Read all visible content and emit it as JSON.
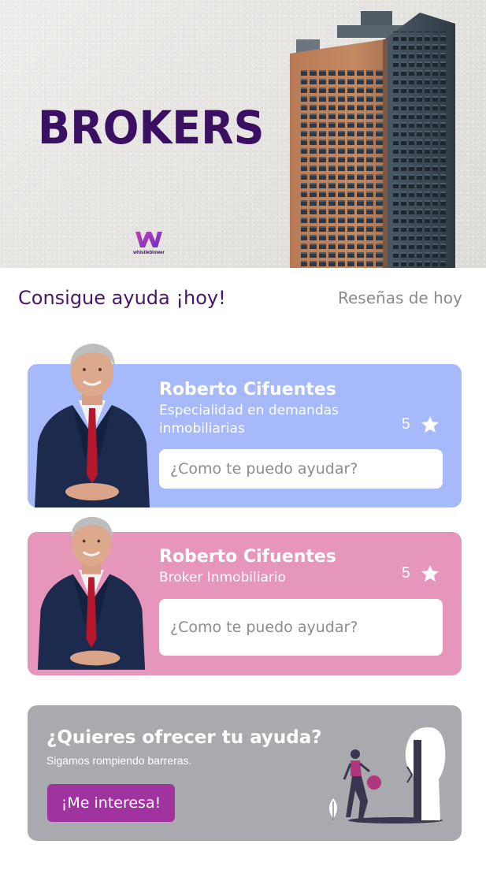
{
  "hero": {
    "title": "BROKERS",
    "logo_text": "whistleblower"
  },
  "tabs": {
    "active": "Consigue ayuda ¡hoy!",
    "secondary": "Reseñas de hoy"
  },
  "brokers": [
    {
      "name": "Roberto Cifuentes",
      "specialty": "Especialidad en demandas inmobiliarias",
      "rating": "5",
      "placeholder": "¿Como te puedo ayudar?",
      "card_color": "#a6b9fb"
    },
    {
      "name": "Roberto Cifuentes",
      "specialty": "Broker Inmobiliario",
      "rating": "5",
      "placeholder": "¿Como te puedo ayudar?",
      "card_color": "#e696ba"
    }
  ],
  "offer": {
    "title": "¿Quieres ofrecer tu ayuda?",
    "subtitle": "Sigamos rompiendo barreras.",
    "button_label": "¡Me interesa!",
    "button_color": "#a0339f",
    "background_color": "#a9aaad"
  },
  "colors": {
    "brand_purple": "#3a1062",
    "tab_active": "#4a1768",
    "tab_inactive": "#8a8a8a"
  },
  "icons": [
    "star-icon",
    "logo-w-icon",
    "building-image",
    "broker-photo",
    "illustration-woman-door"
  ]
}
